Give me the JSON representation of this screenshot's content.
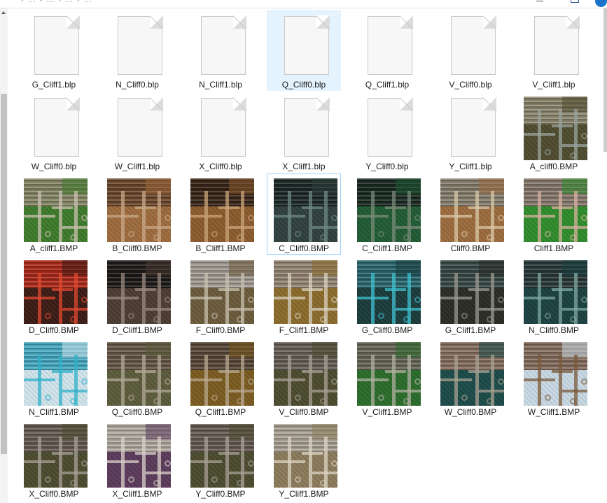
{
  "window": {
    "path_fragment": "› … › … › … › …"
  },
  "files": [
    {
      "name": "G_Cliff1.blp",
      "kind": "blank",
      "state": "none"
    },
    {
      "name": "N_Cliff0.blp",
      "kind": "blank",
      "state": "none"
    },
    {
      "name": "N_Cliff1.blp",
      "kind": "blank",
      "state": "none"
    },
    {
      "name": "Q_Cliff0.blp",
      "kind": "blank",
      "state": "selected"
    },
    {
      "name": "Q_Cliff1.blp",
      "kind": "blank",
      "state": "none"
    },
    {
      "name": "V_Cliff0.blp",
      "kind": "blank",
      "state": "none"
    },
    {
      "name": "V_Cliff1.blp",
      "kind": "blank",
      "state": "none"
    },
    {
      "name": "W_Cliff0.blp",
      "kind": "blank",
      "state": "none"
    },
    {
      "name": "W_Cliff1.blp",
      "kind": "blank",
      "state": "none"
    },
    {
      "name": "X_Cliff0.blp",
      "kind": "blank",
      "state": "none"
    },
    {
      "name": "X_Cliff1.blp",
      "kind": "blank",
      "state": "none"
    },
    {
      "name": "Y_Cliff0.blp",
      "kind": "blank",
      "state": "none"
    },
    {
      "name": "Y_Cliff1.blp",
      "kind": "blank",
      "state": "none"
    },
    {
      "name": "A_cliff0.BMP",
      "kind": "texture",
      "state": "none",
      "base": "#4d4a2e",
      "band": "#8f8a72",
      "line": "#9aa39c"
    },
    {
      "name": "A_cliff1.BMP",
      "kind": "texture",
      "state": "none",
      "base": "#3c7a2a",
      "band": "#8a8a6a",
      "line": "#c9c0b0"
    },
    {
      "name": "B_Cliff0.BMP",
      "kind": "texture",
      "state": "none",
      "base": "#9c6a3c",
      "band": "#6e4a2c",
      "line": "#c9a888"
    },
    {
      "name": "B_Cliff1.BMP",
      "kind": "texture",
      "state": "none",
      "base": "#8a5a2c",
      "band": "#3a2618",
      "line": "#caa47a"
    },
    {
      "name": "C_Cliff0.BMP",
      "kind": "texture",
      "state": "hover",
      "base": "#2f3f3c",
      "band": "#1d2a28",
      "line": "#6e8a82"
    },
    {
      "name": "C_Cliff1.BMP",
      "kind": "texture",
      "state": "none",
      "base": "#1f5a33",
      "band": "#1a2a22",
      "line": "#7a8a7a"
    },
    {
      "name": "Cliff0.BMP",
      "kind": "texture",
      "state": "none",
      "base": "#9a6a3c",
      "band": "#8a8272",
      "line": "#d8c8a8"
    },
    {
      "name": "Cliff1.BMP",
      "kind": "texture",
      "state": "none",
      "base": "#2e8c2a",
      "band": "#8a7c70",
      "line": "#d8b0a0"
    },
    {
      "name": "D_Cliff0.BMP",
      "kind": "texture",
      "state": "none",
      "base": "#3a1a14",
      "band": "#b02a1a",
      "line": "#e04a30"
    },
    {
      "name": "D_Cliff1.BMP",
      "kind": "texture",
      "state": "none",
      "base": "#4a3a32",
      "band": "#1e1a18",
      "line": "#9a8a80"
    },
    {
      "name": "F_Cliff0.BMP",
      "kind": "texture",
      "state": "none",
      "base": "#6a5a3a",
      "band": "#a8a098",
      "line": "#c8c0b0"
    },
    {
      "name": "F_Cliff1.BMP",
      "kind": "texture",
      "state": "none",
      "base": "#8a6a2a",
      "band": "#9a8a78",
      "line": "#d8d0c0"
    },
    {
      "name": "G_Cliff0.BMP",
      "kind": "texture",
      "state": "none",
      "base": "#1a3a3a",
      "band": "#2a6a72",
      "line": "#40c0d0"
    },
    {
      "name": "G_Cliff1.BMP",
      "kind": "texture",
      "state": "none",
      "base": "#2a2a24",
      "band": "#3a4a48",
      "line": "#9a9a90"
    },
    {
      "name": "N_Cliff0.BMP",
      "kind": "texture",
      "state": "none",
      "base": "#1a4040",
      "band": "#2a3a3a",
      "line": "#80a8a0"
    },
    {
      "name": "N_Cliff1.BMP",
      "kind": "texture",
      "state": "none",
      "base": "#d0e4ec",
      "band": "#4ab0c8",
      "line": "#30b0c8"
    },
    {
      "name": "Q_Cliff0.BMP",
      "kind": "texture",
      "state": "none",
      "base": "#5a5a3a",
      "band": "#6a5a4a",
      "line": "#b0a898"
    },
    {
      "name": "Q_Cliff1.BMP",
      "kind": "texture",
      "state": "none",
      "base": "#7a5a1e",
      "band": "#5a4a3a",
      "line": "#b8a890"
    },
    {
      "name": "V_Cliff0.BMP",
      "kind": "texture",
      "state": "none",
      "base": "#4a4a2e",
      "band": "#6a625a",
      "line": "#a8a094"
    },
    {
      "name": "V_Cliff1.BMP",
      "kind": "texture",
      "state": "none",
      "base": "#2a6a2a",
      "band": "#6a6a5a",
      "line": "#b0b0a0"
    },
    {
      "name": "W_Cliff0.BMP",
      "kind": "texture",
      "state": "none",
      "base": "#1a4a48",
      "band": "#8a7262",
      "line": "#a8a090"
    },
    {
      "name": "W_Cliff1.BMP",
      "kind": "texture",
      "state": "none",
      "base": "#c8d8e4",
      "band": "#8a7262",
      "line": "#7a5a3a"
    },
    {
      "name": "X_Cliff0.BMP",
      "kind": "texture",
      "state": "none",
      "base": "#4a4a2e",
      "band": "#6a5e56",
      "line": "#a8a098"
    },
    {
      "name": "X_Cliff1.BMP",
      "kind": "texture",
      "state": "none",
      "base": "#5a3a5a",
      "band": "#b8b0a8",
      "line": "#d8d0c8"
    },
    {
      "name": "Y_Cliff0.BMP",
      "kind": "texture",
      "state": "none",
      "base": "#4a4a2e",
      "band": "#6a5e56",
      "line": "#a8a098"
    },
    {
      "name": "Y_Cliff1.BMP",
      "kind": "texture",
      "state": "none",
      "base": "#8a7a5a",
      "band": "#b0a89a",
      "line": "#dcd4c4"
    }
  ]
}
